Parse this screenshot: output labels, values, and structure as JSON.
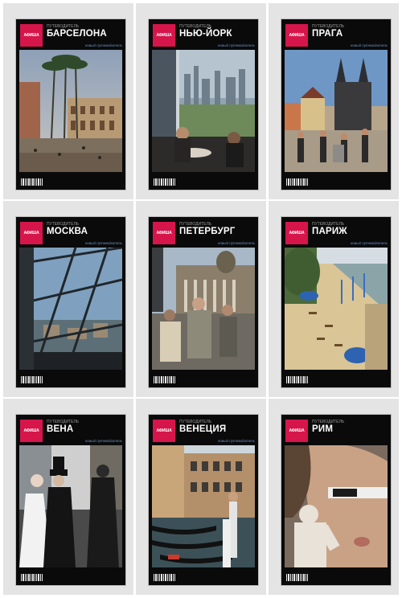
{
  "covers": [
    {
      "brand": "АФИША",
      "kicker": "ПУТЕВОДИТЕЛЬ",
      "city": "БАРСЕЛОНА",
      "tag": "новый путеводитель"
    },
    {
      "brand": "АФИША",
      "kicker": "ПУТЕВОДИТЕЛЬ",
      "city": "НЬЮ-ЙОРК",
      "tag": "новый путеводитель"
    },
    {
      "brand": "АФИША",
      "kicker": "ПУТЕВОДИТЕЛЬ",
      "city": "ПРАГА",
      "tag": "новый путеводитель"
    },
    {
      "brand": "АФИША",
      "kicker": "ПУТЕВОДИТЕЛЬ",
      "city": "МОСКВА",
      "tag": "новый путеводитель"
    },
    {
      "brand": "АФИША",
      "kicker": "ПУТЕВОДИТЕЛЬ",
      "city": "ПЕТЕРБУРГ",
      "tag": "новый путеводитель"
    },
    {
      "brand": "АФИША",
      "kicker": "ПУТЕВОДИТЕЛЬ",
      "city": "ПАРИЖ",
      "tag": "новый путеводитель"
    },
    {
      "brand": "АФИША",
      "kicker": "ПУТЕВОДИТЕЛЬ",
      "city": "ВЕНА",
      "tag": "новый путеводитель"
    },
    {
      "brand": "АФИША",
      "kicker": "ПУТЕВОДИТЕЛЬ",
      "city": "ВЕНЕЦИЯ",
      "tag": "новый путеводитель"
    },
    {
      "brand": "АФИША",
      "kicker": "ПУТЕВОДИТЕЛЬ",
      "city": "РИМ",
      "tag": ""
    }
  ],
  "colors": {
    "logo": "#d6154b",
    "cover_bg": "#0a0a0a",
    "tile_bg": "#e4e4e4"
  }
}
